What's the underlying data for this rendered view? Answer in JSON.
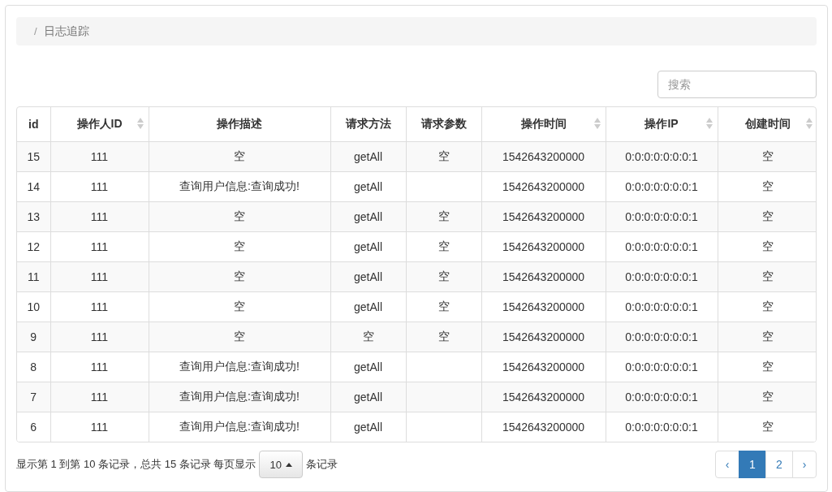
{
  "breadcrumb": {
    "separator": "/",
    "label": "日志追踪"
  },
  "search": {
    "placeholder": "搜索"
  },
  "table": {
    "columns": [
      {
        "label": "id",
        "sortable": false
      },
      {
        "label": "操作人ID",
        "sortable": true
      },
      {
        "label": "操作描述",
        "sortable": false
      },
      {
        "label": "请求方法",
        "sortable": false
      },
      {
        "label": "请求参数",
        "sortable": false
      },
      {
        "label": "操作时间",
        "sortable": true
      },
      {
        "label": "操作IP",
        "sortable": true
      },
      {
        "label": "创建时间",
        "sortable": true
      }
    ],
    "rows": [
      [
        "15",
        "111",
        "空",
        "getAll",
        "空",
        "1542643200000",
        "0:0:0:0:0:0:0:1",
        "空"
      ],
      [
        "14",
        "111",
        "查询用户信息:查询成功!",
        "getAll",
        "",
        "1542643200000",
        "0:0:0:0:0:0:0:1",
        "空"
      ],
      [
        "13",
        "111",
        "空",
        "getAll",
        "空",
        "1542643200000",
        "0:0:0:0:0:0:0:1",
        "空"
      ],
      [
        "12",
        "111",
        "空",
        "getAll",
        "空",
        "1542643200000",
        "0:0:0:0:0:0:0:1",
        "空"
      ],
      [
        "11",
        "111",
        "空",
        "getAll",
        "空",
        "1542643200000",
        "0:0:0:0:0:0:0:1",
        "空"
      ],
      [
        "10",
        "111",
        "空",
        "getAll",
        "空",
        "1542643200000",
        "0:0:0:0:0:0:0:1",
        "空"
      ],
      [
        "9",
        "111",
        "空",
        "空",
        "空",
        "1542643200000",
        "0:0:0:0:0:0:0:1",
        "空"
      ],
      [
        "8",
        "111",
        "查询用户信息:查询成功!",
        "getAll",
        "",
        "1542643200000",
        "0:0:0:0:0:0:0:1",
        "空"
      ],
      [
        "7",
        "111",
        "查询用户信息:查询成功!",
        "getAll",
        "",
        "1542643200000",
        "0:0:0:0:0:0:0:1",
        "空"
      ],
      [
        "6",
        "111",
        "查询用户信息:查询成功!",
        "getAll",
        "",
        "1542643200000",
        "0:0:0:0:0:0:0:1",
        "空"
      ]
    ]
  },
  "footer": {
    "summary": "显示第 1 到第 10 条记录，总共 15 条记录 每页显示",
    "page_size": "10",
    "suffix": "条记录"
  },
  "pagination": [
    {
      "label": "‹",
      "kind": "prev",
      "selected": false
    },
    {
      "label": "1",
      "kind": "page",
      "selected": true
    },
    {
      "label": "2",
      "kind": "page",
      "selected": false
    },
    {
      "label": "›",
      "kind": "next",
      "selected": false
    }
  ]
}
